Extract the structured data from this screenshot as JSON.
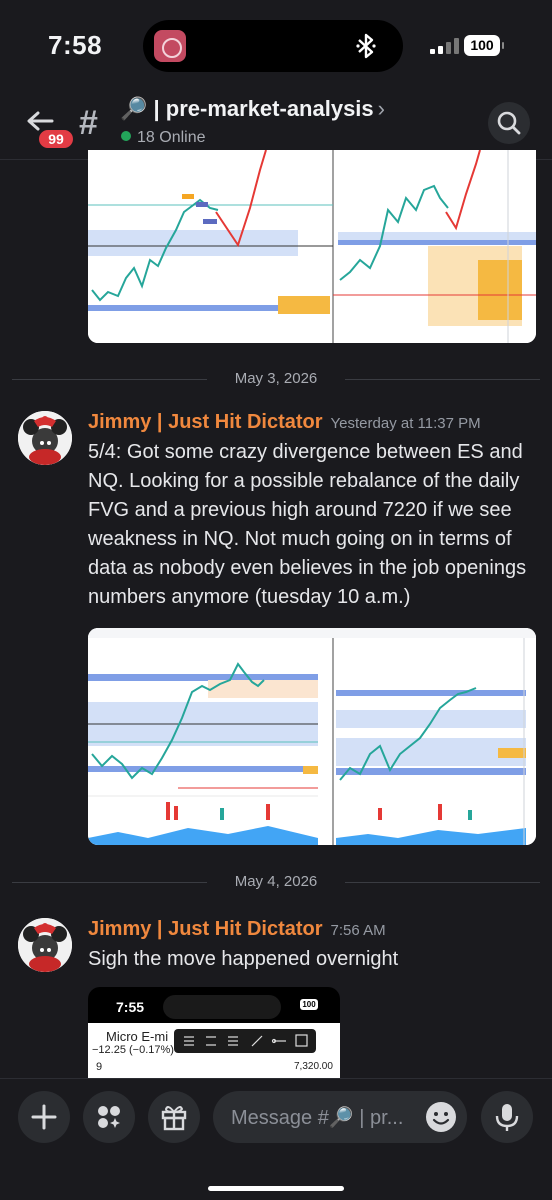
{
  "status_bar": {
    "time": "7:58",
    "battery": "100"
  },
  "header": {
    "unread_count": "99",
    "channel_name": "🔎 | pre-market-analysis",
    "chevron": "›",
    "online_text": "18 Online"
  },
  "dates": {
    "first": "May 3, 2026",
    "second": "May 4, 2026"
  },
  "messages": [
    {
      "author": "Jimmy | Just Hit Dictator",
      "timestamp": "Yesterday at 11:37 PM",
      "text": "5/4: Got some crazy divergence between ES and NQ. Looking for a possible rebalance of the daily FVG and a previous high around 7220 if we see weakness in NQ. Not much going on in terms of data as nobody even believes in the job openings numbers anymore (tuesday 10 a.m.)"
    },
    {
      "author": "Jimmy | Just Hit Dictator",
      "timestamp": "7:56 AM",
      "text": "Sigh the move happened overnight"
    }
  ],
  "attached_screenshot": {
    "time": "7:55",
    "battery": "100",
    "symbol_title": "Micro E-mi",
    "change": "−12.25 (−0.17%)",
    "interval": "9",
    "price": "7,320.00"
  },
  "composer": {
    "placeholder": "Message #🔎 | pr..."
  },
  "colors": {
    "author": "#f0883e",
    "online": "#23a55a",
    "badge": "#e23b44",
    "background": "#1a1a1e"
  }
}
